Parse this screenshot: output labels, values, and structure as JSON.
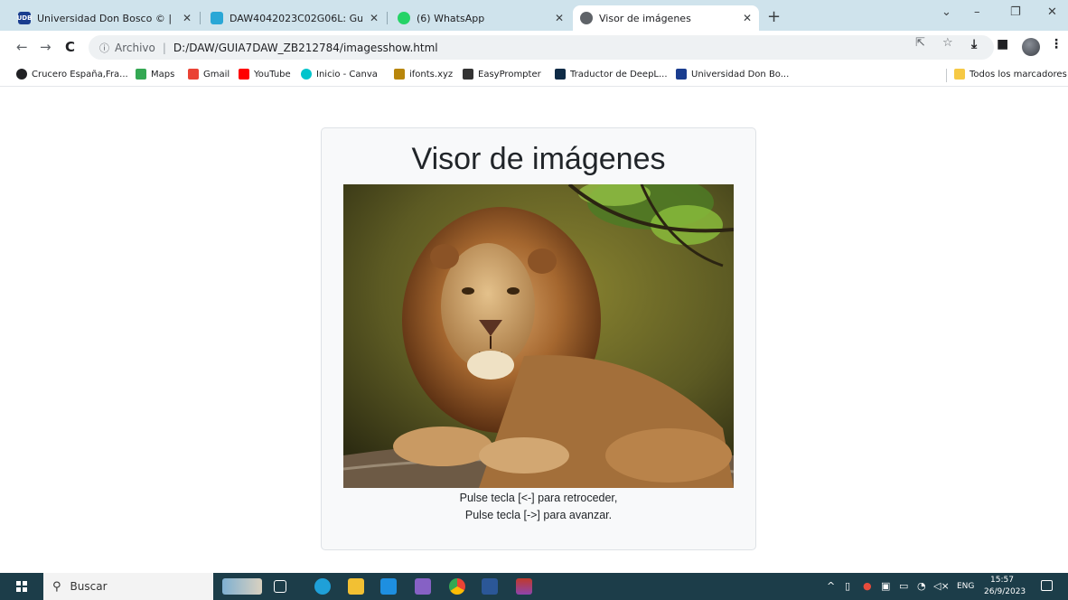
{
  "browser": {
    "tabs": [
      {
        "label": "Universidad Don Bosco © | Inicio",
        "icon": "udb-icon",
        "favicon_text": "UDB",
        "color": "#1a3d8f",
        "active": false
      },
      {
        "label": "DAW4042023C02G06L: Guía 7",
        "icon": "classroom-icon",
        "favicon_text": "",
        "color": "#2aa7d6",
        "active": false
      },
      {
        "label": "(6) WhatsApp",
        "icon": "whatsapp-icon",
        "favicon_text": "",
        "color": "#25d366",
        "active": false
      },
      {
        "label": "Visor de imágenes",
        "icon": "globe-icon",
        "favicon_text": "",
        "color": "#5f6368",
        "active": true
      }
    ],
    "toolbar": {
      "security_label": "Archivo",
      "url": "D:/DAW/GUIA7DAW_ZB212784/imagesshow.html"
    },
    "bookmarks": [
      {
        "label": "Crucero España,Fra...",
        "icon": "globe-icon",
        "color": "#202124"
      },
      {
        "label": "Maps",
        "icon": "maps-icon",
        "color": "#34a853"
      },
      {
        "label": "Gmail",
        "icon": "gmail-icon",
        "color": "#ea4335"
      },
      {
        "label": "YouTube",
        "icon": "youtube-icon",
        "color": "#ff0000"
      },
      {
        "label": "Inicio - Canva",
        "icon": "canva-icon",
        "color": "#00c4cc"
      },
      {
        "label": "ifonts.xyz",
        "icon": "ifonts-icon",
        "color": "#b8860b"
      },
      {
        "label": "EasyPrompter",
        "icon": "prompter-icon",
        "color": "#333333"
      },
      {
        "label": "Traductor de DeepL...",
        "icon": "deepl-icon",
        "color": "#0f2b46"
      },
      {
        "label": "Universidad Don Bo...",
        "icon": "udb-icon",
        "color": "#1a3d8f"
      }
    ],
    "all_bookmarks_label": "Todos los marcadores"
  },
  "page": {
    "title": "Visor de imágenes",
    "image_alt": "lion",
    "caption_line1": "Pulse tecla [<-] para retroceder,",
    "caption_line2": "Pulse tecla [->] para avanzar."
  },
  "taskbar": {
    "search_placeholder": "Buscar",
    "language": "ENG",
    "time": "15:57",
    "date": "26/9/2023"
  },
  "colors": {
    "tabstrip": "#cfe3ec",
    "taskbar": "#1c3d49",
    "card_bg": "#f8f9fa"
  }
}
